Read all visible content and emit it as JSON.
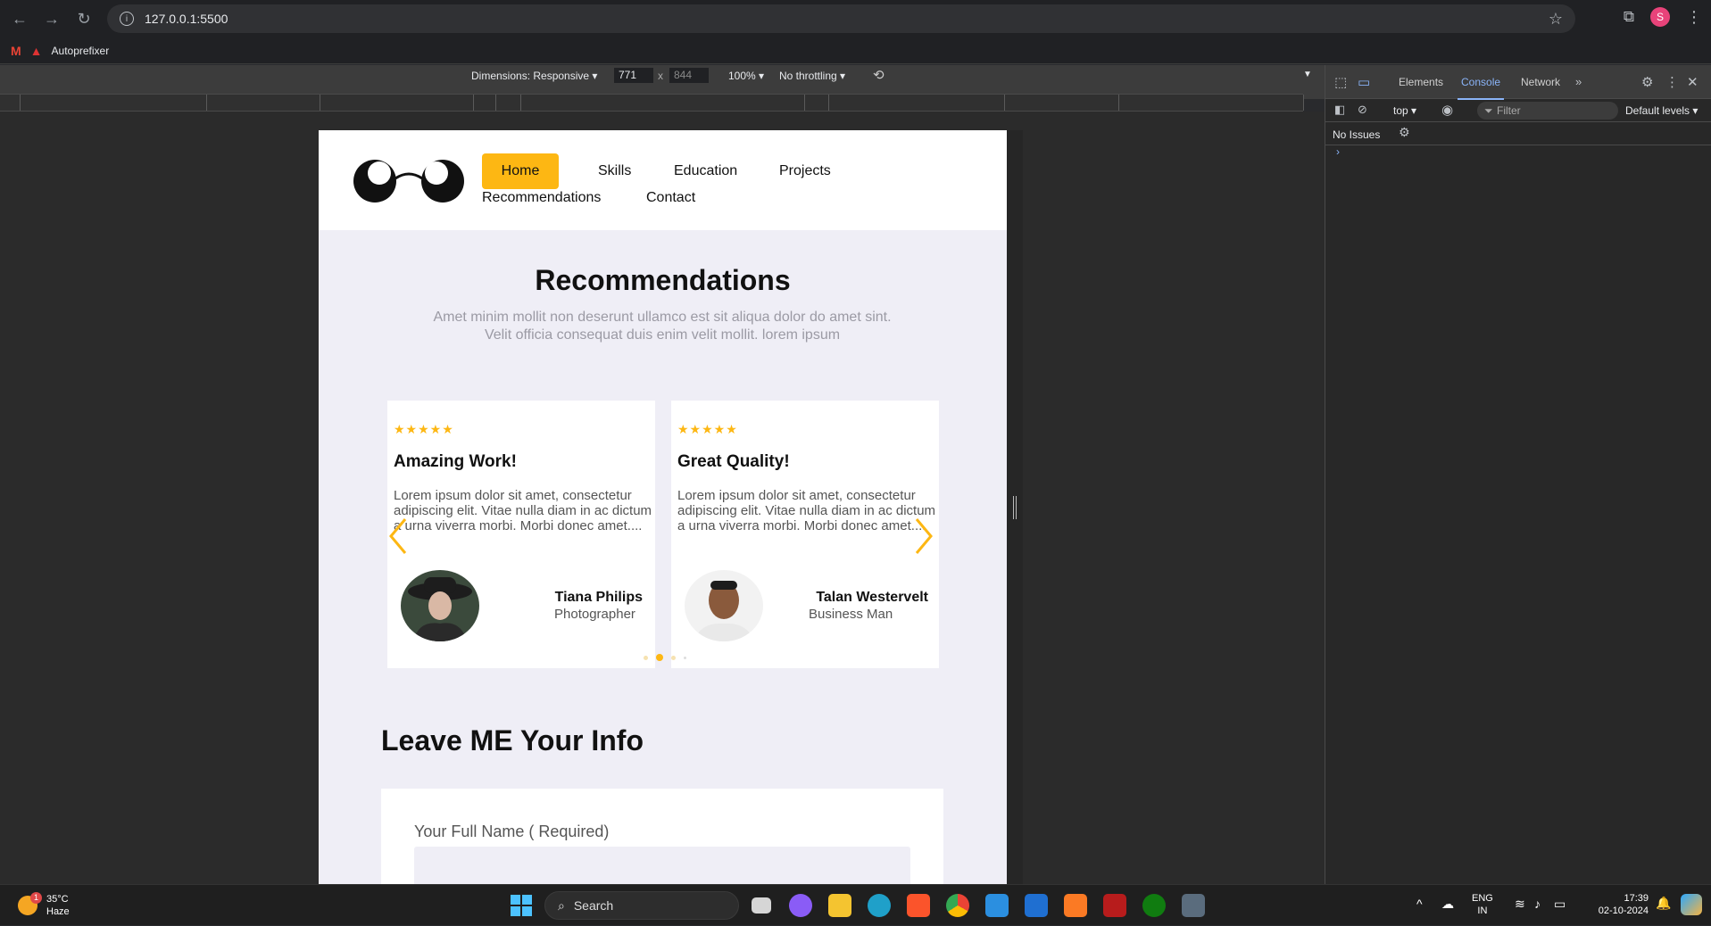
{
  "browser": {
    "url": "127.0.0.1:5500",
    "bookmark": "Autoprefixer"
  },
  "device_toolbar": {
    "dimensions_label": "Dimensions: Responsive",
    "width": "771",
    "height": "844",
    "zoom": "100%",
    "throttling": "No throttling"
  },
  "devtools": {
    "tabs": [
      "Elements",
      "Console",
      "Network"
    ],
    "active_tab": "Console",
    "context": "top",
    "filter_placeholder": "Filter",
    "levels": "Default levels",
    "issues": "No Issues"
  },
  "site": {
    "nav": {
      "home": "Home",
      "skills": "Skills",
      "education": "Education",
      "projects": "Projects",
      "recommendations": "Recommendations",
      "contact": "Contact"
    },
    "recommendations": {
      "title": "Recommendations",
      "subtitle": "Amet minim mollit non deserunt ullamco est sit aliqua dolor do amet sint. Velit officia consequat duis enim velit mollit. lorem ipsum",
      "cards": [
        {
          "stars": "★★★★★",
          "title": "Amazing Work!",
          "text": "Lorem ipsum dolor sit amet, consectetur adipiscing elit. Vitae nulla diam in ac dictum a urna viverra morbi. Morbi donec amet....",
          "name": "Tiana Philips",
          "role": "Photographer"
        },
        {
          "stars": "★★★★★",
          "title": "Great Quality!",
          "text": "Lorem ipsum dolor sit amet, consectetur adipiscing elit. Vitae nulla diam in ac dictum a urna viverra morbi. Morbi donec amet....",
          "name": "Talan Westervelt",
          "role": "Business Man"
        }
      ],
      "active_dot": 2
    },
    "info": {
      "title": "Leave ME Your Info",
      "name_label": "Your Full Name ( Required)"
    }
  },
  "taskbar": {
    "temperature": "35°C",
    "weather": "Haze",
    "search": "Search",
    "lang": "ENG",
    "region": "IN",
    "time": "17:39",
    "date": "02-10-2024"
  },
  "colors": {
    "accent": "#fdb713",
    "page_bg": "#efeef6"
  }
}
